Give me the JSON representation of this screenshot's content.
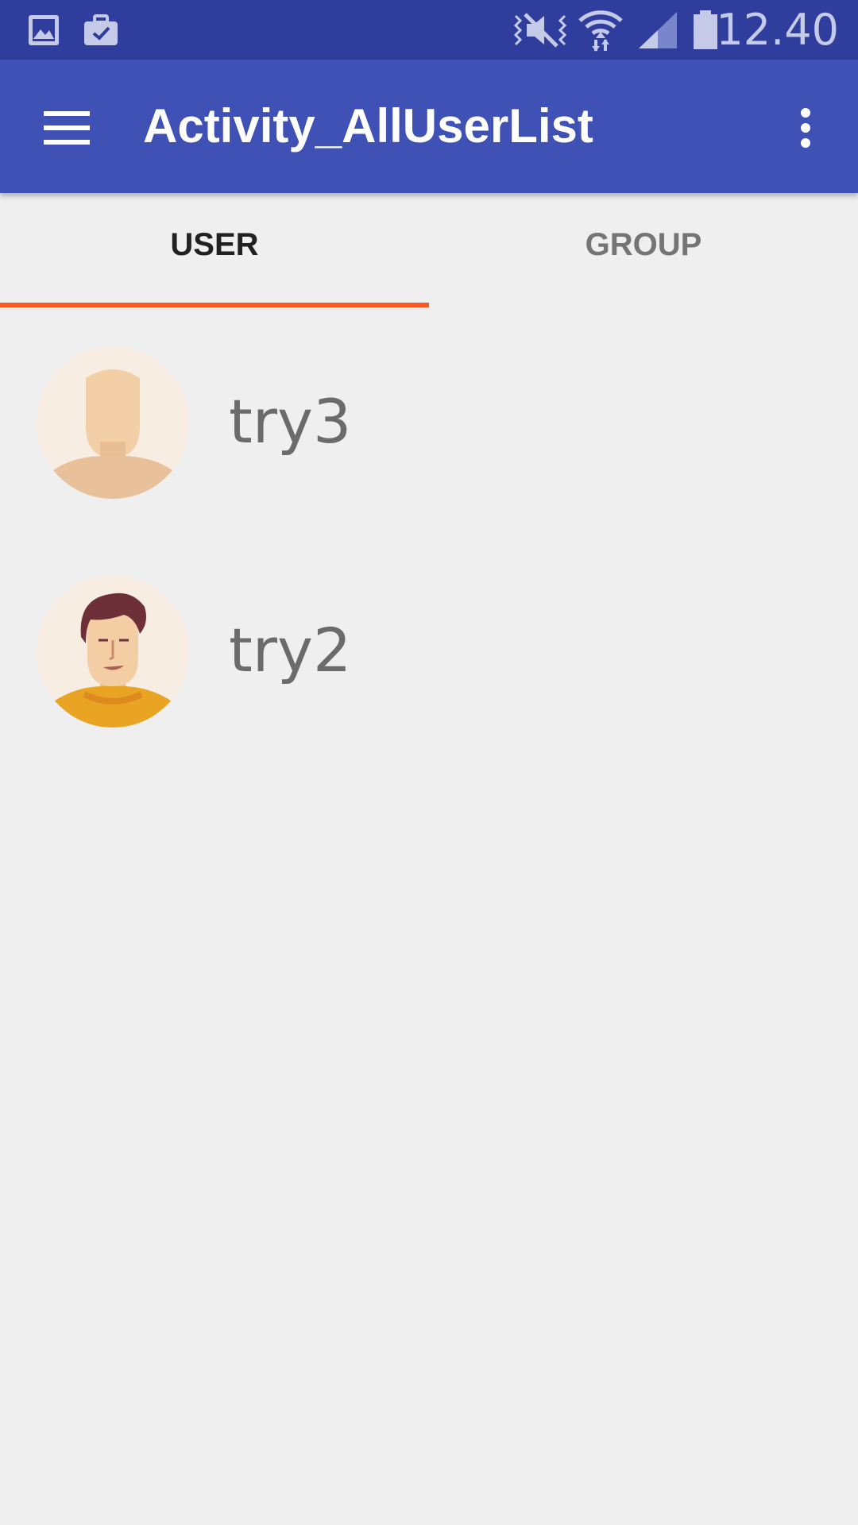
{
  "status_bar": {
    "time": "12.40",
    "icons": [
      "gallery-icon",
      "briefcase-check-icon",
      "vibrate-mute-icon",
      "wifi-icon",
      "signal-icon",
      "battery-icon"
    ]
  },
  "app_bar": {
    "title": "Activity_AllUserList",
    "color": "#3f51b5"
  },
  "tabs": [
    {
      "label": "USER",
      "selected": true
    },
    {
      "label": "GROUP",
      "selected": false
    }
  ],
  "accent_color": "#ff5722",
  "users": [
    {
      "name": "try3",
      "avatar": "default-avatar-icon"
    },
    {
      "name": "try2",
      "avatar": "man-avatar-icon"
    }
  ]
}
